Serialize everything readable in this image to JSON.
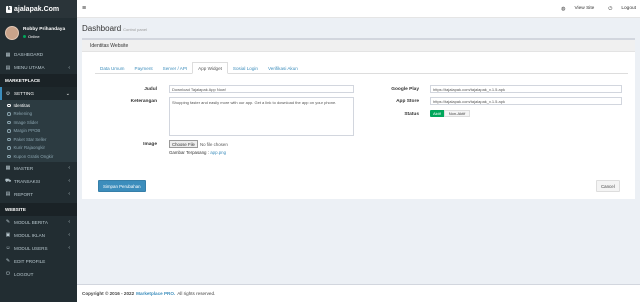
{
  "brand": {
    "logo_text": "ajalapak.Com",
    "logo_icon": "k"
  },
  "user": {
    "name": "Robby Prihandaya",
    "status": "Online"
  },
  "sidebar": {
    "top_items": [
      {
        "label": "DASHBOARD",
        "icon": "dashboard-icon"
      },
      {
        "label": "MENU UTAMA",
        "icon": "grid-icon"
      }
    ],
    "marketplace_header": "MARKETPLACE",
    "setting_label": "SETTING",
    "setting_subitems": [
      "Identitas",
      "Rekening",
      "Image Slider",
      "Margin PPOB",
      "Paket Star Seller",
      "Kurir Rajaongkir",
      "Kupon Gratis Ongkir"
    ],
    "mid_items": [
      {
        "label": "MASTER"
      },
      {
        "label": "TRANSAKSI"
      },
      {
        "label": "REPORT"
      }
    ],
    "website_header": "WEBSITE",
    "website_items": [
      {
        "label": "MODUL BERITA"
      },
      {
        "label": "MODUL IKLAN"
      },
      {
        "label": "MODUL USERS"
      },
      {
        "label": "EDIT PROFILE"
      },
      {
        "label": "LOGOUT"
      }
    ]
  },
  "topbar": {
    "view_site": "View Site",
    "logout": "Logout"
  },
  "page": {
    "title": "Dashboard",
    "subtitle": "Control panel"
  },
  "box": {
    "title": "Identitas Website"
  },
  "tabs": [
    "Data Umum",
    "Payment",
    "Server / API",
    "App Widget",
    "Sosial Login",
    "Verifikasi Akun"
  ],
  "active_tab": "App Widget",
  "form": {
    "judul_label": "Judul",
    "judul_value": "Download Tajalapak App Now!",
    "keterangan_label": "Keterangan",
    "keterangan_value": "Shopping faster and easily more with our app. Get a link to download the app on your phone.",
    "image_label": "Image",
    "file_button": "Choose File",
    "file_status": "No file chosen",
    "current_image_prefix": "Gambar Terpasang :",
    "current_image_file": "app.png",
    "google_play_label": "Google Play",
    "google_play_value": "https://tajalapak.com/tajalapak_v.1.5.apk",
    "app_store_label": "App Store",
    "app_store_value": "https://tajalapak.com/tajalapak_v.1.5.apk",
    "status_label": "Status",
    "status_on": "Aktif",
    "status_off": "Non-Aktif"
  },
  "buttons": {
    "save": "Simpan Perubahan",
    "cancel": "Cancel"
  },
  "footer": {
    "copyright": "Copyright © 2016 - 2022",
    "brand": "Marketplace PRO.",
    "rights": "All rights reserved."
  },
  "colors": {
    "sidebar": "#222d32",
    "accent": "#3c8dbc",
    "success": "#00a65a"
  }
}
